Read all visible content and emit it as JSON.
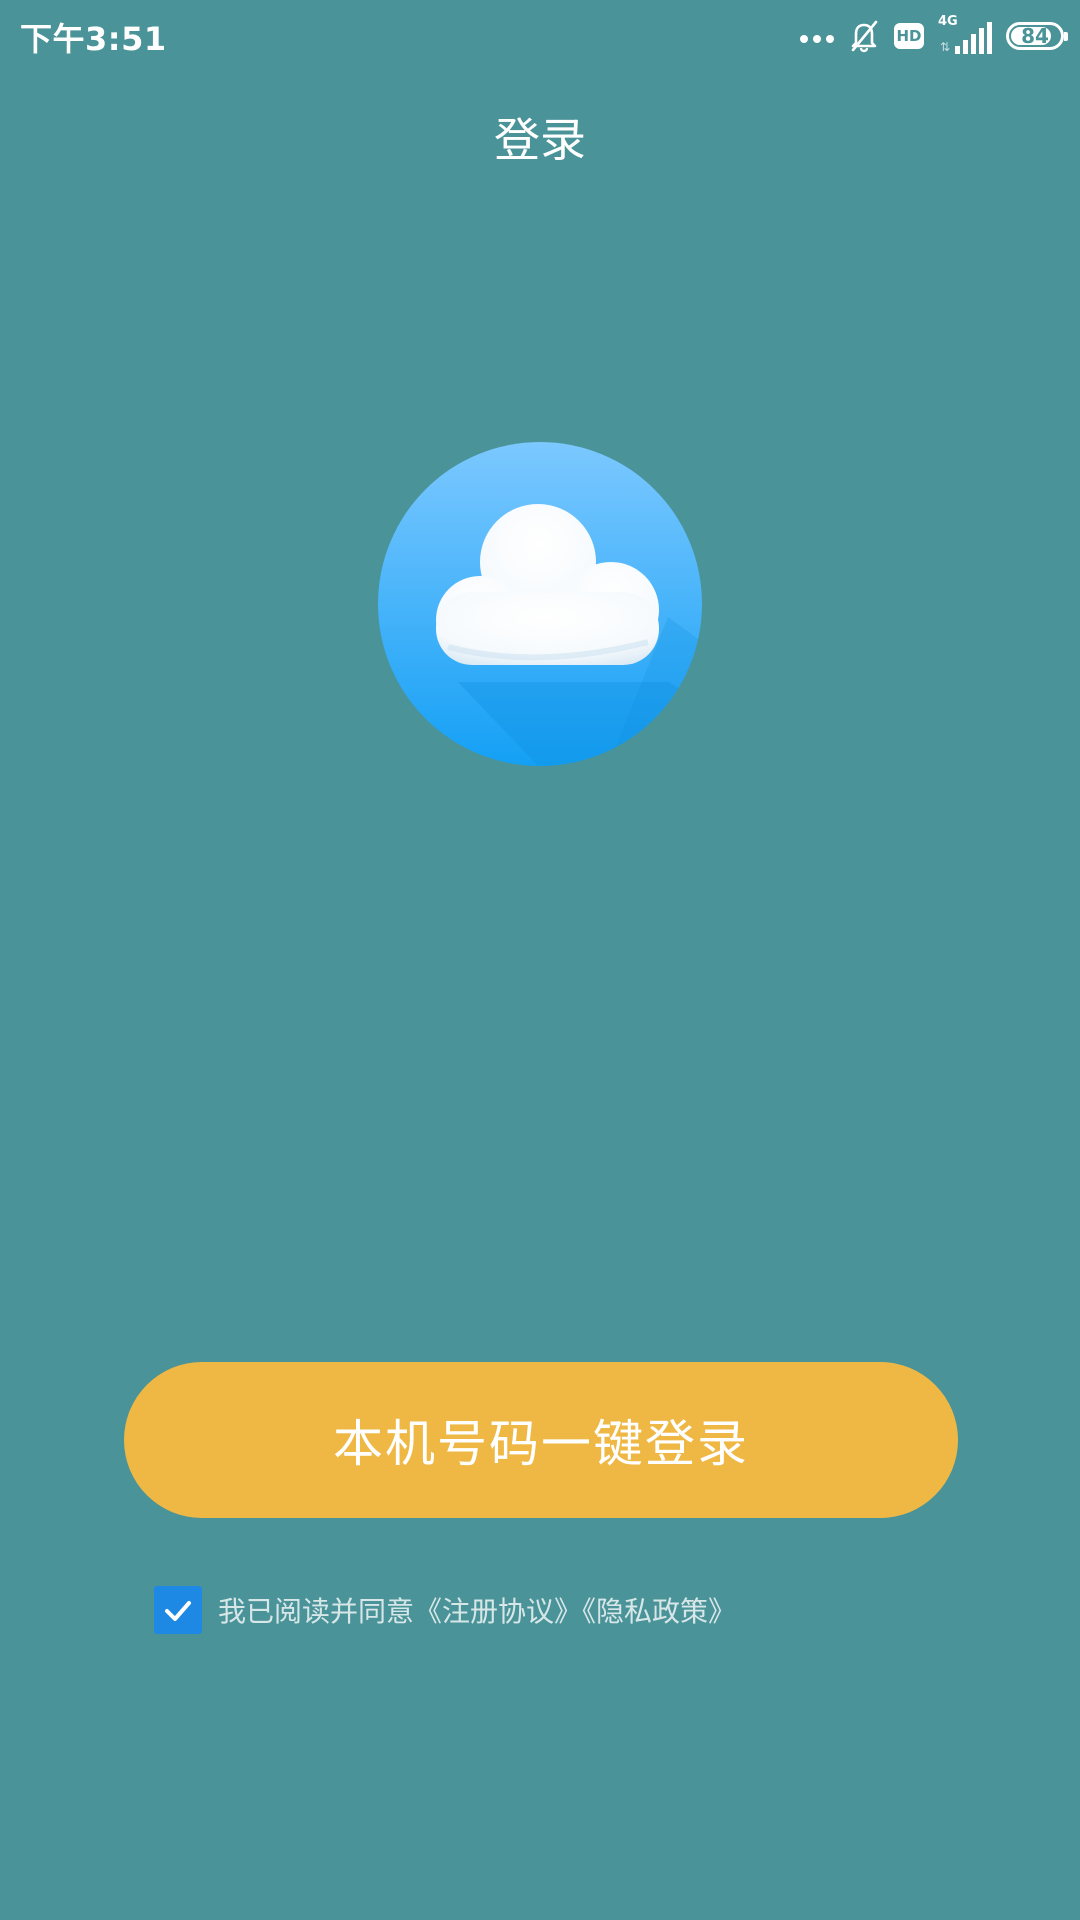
{
  "status_bar": {
    "time": "下午3:51",
    "network": "4G",
    "hd": "HD",
    "battery": "84",
    "battery_level": 0.84,
    "icons": [
      "more-dots-icon",
      "bell-off-icon",
      "hd-icon",
      "signal-icon",
      "battery-icon"
    ]
  },
  "header": {
    "title": "登录"
  },
  "logo": {
    "icon": "cloud-icon"
  },
  "login_button": {
    "label": "本机号码一键登录",
    "color": "#efb845"
  },
  "agreement": {
    "checked": true,
    "text": "我已阅读并同意《注册协议》《隐私政策》",
    "checkbox_color": "#1e88e5"
  },
  "colors": {
    "background": "#4a9399"
  }
}
